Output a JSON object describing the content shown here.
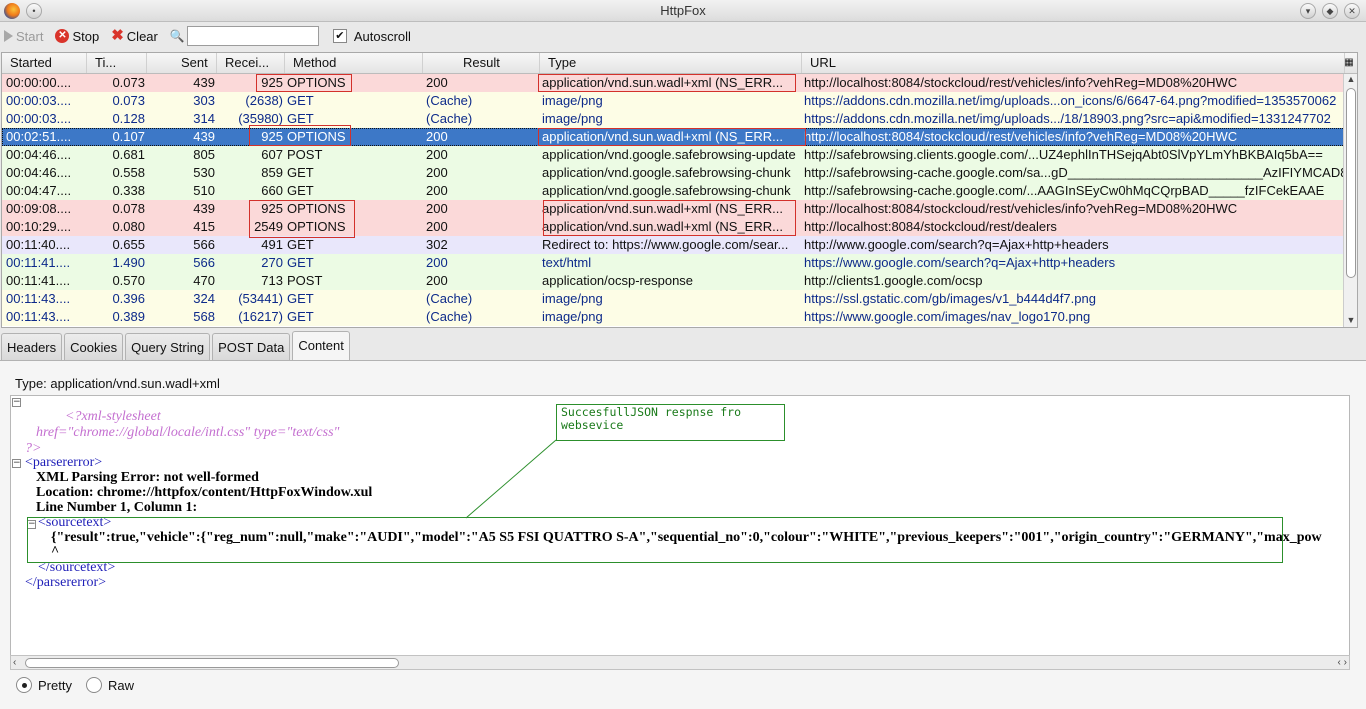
{
  "window": {
    "title": "HttpFox"
  },
  "toolbar": {
    "start_label": "Start",
    "stop_label": "Stop",
    "clear_label": "Clear",
    "search_value": "",
    "autoscroll_label": "Autoscroll",
    "autoscroll_checked": true
  },
  "grid": {
    "columns": [
      "Started",
      "Ti...",
      "Sent",
      "Recei...",
      "Method",
      "Result",
      "Type",
      "URL"
    ],
    "rows": [
      {
        "started": "00:00:00....",
        "time": "0.073",
        "sent": "439",
        "recv": "925",
        "method": "OPTIONS",
        "result": "200",
        "type": "application/vnd.sun.wadl+xml (NS_ERR...",
        "url": "http://localhost:8084/stockcloud/rest/vehicles/info?vehReg=MD08%20HWC",
        "style": "red"
      },
      {
        "started": "00:00:03....",
        "time": "0.073",
        "sent": "303",
        "recv": "(2638)",
        "method": "GET",
        "result": "(Cache)",
        "type": "image/png",
        "url": "https://addons.cdn.mozilla.net/img/uploads...on_icons/6/6647-64.png?modified=1353570062",
        "style": "yellow"
      },
      {
        "started": "00:00:03....",
        "time": "0.128",
        "sent": "314",
        "recv": "(35980)",
        "method": "GET",
        "result": "(Cache)",
        "type": "image/png",
        "url": "https://addons.cdn.mozilla.net/img/uploads.../18/18903.png?src=api&modified=1331247702",
        "style": "yellow"
      },
      {
        "started": "00:02:51....",
        "time": "0.107",
        "sent": "439",
        "recv": "925",
        "method": "OPTIONS",
        "result": "200",
        "type": "application/vnd.sun.wadl+xml (NS_ERR...",
        "url": "http://localhost:8084/stockcloud/rest/vehicles/info?vehReg=MD08%20HWC",
        "style": "sel"
      },
      {
        "started": "00:04:46....",
        "time": "0.681",
        "sent": "805",
        "recv": "607",
        "method": "POST",
        "result": "200",
        "type": "application/vnd.google.safebrowsing-update",
        "url": "http://safebrowsing.clients.google.com/...UZ4ephlInTHSejqAbt0SlVpYLmYhBKBAIq5bA==",
        "style": "green"
      },
      {
        "started": "00:04:46....",
        "time": "0.558",
        "sent": "530",
        "recv": "859",
        "method": "GET",
        "result": "200",
        "type": "application/vnd.google.safebrowsing-chunk",
        "url": "http://safebrowsing-cache.google.com/sa...gD___________________________AzIFIYMCAD8",
        "style": "green"
      },
      {
        "started": "00:04:47....",
        "time": "0.338",
        "sent": "510",
        "recv": "660",
        "method": "GET",
        "result": "200",
        "type": "application/vnd.google.safebrowsing-chunk",
        "url": "http://safebrowsing-cache.google.com/...AAGInSEyCw0hMqCQrpBAD_____fzIFCekEAAE",
        "style": "green"
      },
      {
        "started": "00:09:08....",
        "time": "0.078",
        "sent": "439",
        "recv": "925",
        "method": "OPTIONS",
        "result": "200",
        "type": "application/vnd.sun.wadl+xml (NS_ERR...",
        "url": "http://localhost:8084/stockcloud/rest/vehicles/info?vehReg=MD08%20HWC",
        "style": "red"
      },
      {
        "started": "00:10:29....",
        "time": "0.080",
        "sent": "415",
        "recv": "2549",
        "method": "OPTIONS",
        "result": "200",
        "type": "application/vnd.sun.wadl+xml (NS_ERR...",
        "url": "http://localhost:8084/stockcloud/rest/dealers",
        "style": "red"
      },
      {
        "started": "00:11:40....",
        "time": "0.655",
        "sent": "566",
        "recv": "491",
        "method": "GET",
        "result": "302",
        "type": "Redirect to: https://www.google.com/sear...",
        "url": "http://www.google.com/search?q=Ajax+http+headers",
        "style": "purple"
      },
      {
        "started": "00:11:41....",
        "time": "1.490",
        "sent": "566",
        "recv": "270",
        "method": "GET",
        "result": "200",
        "type": "text/html",
        "url": "https://www.google.com/search?q=Ajax+http+headers",
        "style": "greenblue"
      },
      {
        "started": "00:11:41....",
        "time": "0.570",
        "sent": "470",
        "recv": "713",
        "method": "POST",
        "result": "200",
        "type": "application/ocsp-response",
        "url": "http://clients1.google.com/ocsp",
        "style": "green"
      },
      {
        "started": "00:11:43....",
        "time": "0.396",
        "sent": "324",
        "recv": "(53441)",
        "method": "GET",
        "result": "(Cache)",
        "type": "image/png",
        "url": "https://ssl.gstatic.com/gb/images/v1_b444d4f7.png",
        "style": "yellow"
      },
      {
        "started": "00:11:43....",
        "time": "0.389",
        "sent": "568",
        "recv": "(16217)",
        "method": "GET",
        "result": "(Cache)",
        "type": "image/png",
        "url": "https://www.google.com/images/nav_logo170.png",
        "style": "yellow"
      }
    ]
  },
  "tabs": [
    {
      "label": "Headers",
      "active": false
    },
    {
      "label": "Cookies",
      "active": false
    },
    {
      "label": "Query String",
      "active": false
    },
    {
      "label": "POST Data",
      "active": false
    },
    {
      "label": "Content",
      "active": true
    }
  ],
  "content": {
    "type_line": "Type: application/vnd.sun.wadl+xml",
    "pi_line1": "<?xml-stylesheet",
    "pi_line2": "href=\"chrome://global/locale/intl.css\" type=\"text/css\"",
    "pi_line3": "?>",
    "parsererror_open": "<parsererror>",
    "err1": "XML Parsing Error: not well-formed",
    "err2": "Location: chrome://httpfox/content/HttpFoxWindow.xul",
    "err3": "Line Number 1, Column 1:",
    "sourcetext_open": "<sourcetext>",
    "source_json": "{\"result\":true,\"vehicle\":{\"reg_num\":null,\"make\":\"AUDI\",\"model\":\"A5 S5 FSI QUATTRO S-A\",\"sequential_no\":0,\"colour\":\"WHITE\",\"previous_keepers\":\"001\",\"origin_country\":\"GERMANY\",\"max_pow",
    "caret": "^",
    "sourcetext_close": "</sourcetext>",
    "parsererror_close": "</parsererror>",
    "callout_text": "SuccesfullJSON respnse fro websevice"
  },
  "view_mode": {
    "pretty_label": "Pretty",
    "raw_label": "Raw",
    "selected": "Pretty"
  },
  "colors": {
    "row_red": "#fbd9d9",
    "row_green": "#ecfbe4",
    "row_yellow": "#fdfde6",
    "row_selected": "#3d78c7",
    "annotation_red": "#d3312b",
    "annotation_green": "#2c8f2c"
  }
}
